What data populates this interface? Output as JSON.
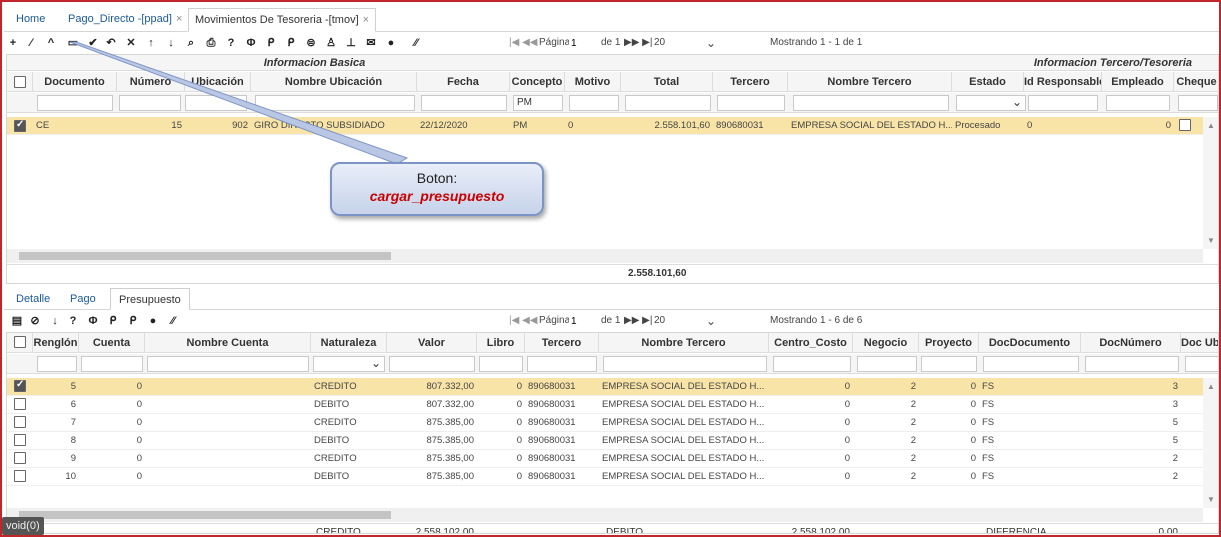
{
  "tabs": [
    {
      "label": "Home"
    },
    {
      "label": "Pago_Directo -[ppad]",
      "close": "×"
    },
    {
      "label": "Movimientos De Tesoreria -[tmov]",
      "close": "×"
    }
  ],
  "toolbar": {
    "icons": [
      {
        "name": "add-icon",
        "glyph": "+"
      },
      {
        "name": "edit-icon",
        "glyph": "⁄"
      },
      {
        "name": "up-icon",
        "glyph": "^"
      },
      {
        "name": "rectangle-icon",
        "glyph": "▭"
      },
      {
        "name": "check-icon",
        "glyph": "✔"
      },
      {
        "name": "undo-icon",
        "glyph": "↶"
      },
      {
        "name": "cancel-icon",
        "glyph": "✕"
      },
      {
        "name": "arrow-up-icon",
        "glyph": "↑"
      },
      {
        "name": "arrow-down-icon",
        "glyph": "↓"
      },
      {
        "name": "search-icon",
        "glyph": "⌕"
      },
      {
        "name": "print-icon",
        "glyph": "⎙"
      },
      {
        "name": "help-icon",
        "glyph": "?"
      },
      {
        "name": "filter-icon",
        "glyph": "Φ"
      },
      {
        "name": "zoom-in-icon",
        "glyph": "ᑭ"
      },
      {
        "name": "zoom-out-icon",
        "glyph": "ᑭ"
      },
      {
        "name": "comment-icon",
        "glyph": "⊜"
      },
      {
        "name": "user-icon",
        "glyph": "♙"
      },
      {
        "name": "pin-icon",
        "glyph": "⊥"
      },
      {
        "name": "mail-icon",
        "glyph": "✉"
      },
      {
        "name": "add-circle-icon",
        "glyph": "●"
      },
      {
        "name": "resize-icon",
        "glyph": "⁄⁄"
      }
    ],
    "pager": {
      "nav_left": "|◀ ◀◀",
      "page_label": "Página",
      "page": "1",
      "of": "de 1",
      "nav_right": "▶▶ ▶|",
      "per_page": "20",
      "caret": "⌄",
      "showing": "Mostrando 1 - 1 de 1"
    }
  },
  "master": {
    "group_basic": "Informacion Basica",
    "group_third": "Informacion Tercero/Tesoreria",
    "columns": [
      "Documento",
      "Número",
      "Ubicación",
      "Nombre Ubicación",
      "Fecha",
      "Concepto",
      "Motivo",
      "Total",
      "Tercero",
      "Nombre Tercero",
      "Estado",
      "Id Responsable",
      "Empleado",
      "Cheque"
    ],
    "filter_concepto": "PM",
    "filter_estado_caret": "⌄",
    "row": {
      "documento": "CE",
      "numero": "15",
      "ubicacion": "902",
      "nombre_ubicacion": "GIRO DIRECTO SUBSIDIADO",
      "fecha": "22/12/2020",
      "concepto": "PM",
      "motivo": "0",
      "total": "2.558.101,60",
      "tercero": "890680031",
      "nombre_tercero": "EMPRESA SOCIAL DEL ESTADO H...",
      "estado": "Procesado",
      "id_responsable": "0",
      "empleado": "0"
    },
    "footer_total": "2.558.101,60"
  },
  "tooltip": {
    "line1": "Boton:",
    "line2": "cargar_presupuesto"
  },
  "subtabs": [
    {
      "label": "Detalle"
    },
    {
      "label": "Pago"
    },
    {
      "label": "Presupuesto"
    }
  ],
  "detail_toolbar": {
    "icons": [
      {
        "name": "save-icon",
        "glyph": "▤"
      },
      {
        "name": "block-icon",
        "glyph": "⊘"
      },
      {
        "name": "arrow-down-icon",
        "glyph": "↓"
      },
      {
        "name": "help-icon",
        "glyph": "?"
      },
      {
        "name": "filter-icon",
        "glyph": "Φ"
      },
      {
        "name": "zoom-in-icon",
        "glyph": "ᑭ"
      },
      {
        "name": "zoom-out-icon",
        "glyph": "ᑭ"
      },
      {
        "name": "add-circle-icon",
        "glyph": "●"
      },
      {
        "name": "resize-icon",
        "glyph": "⁄⁄"
      }
    ],
    "pager": {
      "nav_left": "|◀ ◀◀",
      "page_label": "Página",
      "page": "1",
      "of": "de 1",
      "nav_right": "▶▶ ▶|",
      "per_page": "20",
      "caret": "⌄",
      "showing": "Mostrando 1 - 6 de 6"
    }
  },
  "detail": {
    "columns": [
      "Renglón",
      "Cuenta",
      "Nombre Cuenta",
      "Naturaleza",
      "Valor",
      "Libro",
      "Tercero",
      "Nombre Tercero",
      "Centro_Costo",
      "Negocio",
      "Proyecto",
      "DocDocumento",
      "DocNúmero",
      "Doc Ub"
    ],
    "naturaleza_caret": "⌄",
    "rows": [
      {
        "renglon": "5",
        "cuenta": "0",
        "naturaleza": "CREDITO",
        "valor": "807.332,00",
        "libro": "0",
        "tercero": "890680031",
        "nombre_tercero": "EMPRESA SOCIAL DEL ESTADO H...",
        "centro": "0",
        "negocio": "2",
        "proyecto": "0",
        "docdoc": "FS",
        "docnum": "3",
        "selected": true
      },
      {
        "renglon": "6",
        "cuenta": "0",
        "naturaleza": "DEBITO",
        "valor": "807.332,00",
        "libro": "0",
        "tercero": "890680031",
        "nombre_tercero": "EMPRESA SOCIAL DEL ESTADO H...",
        "centro": "0",
        "negocio": "2",
        "proyecto": "0",
        "docdoc": "FS",
        "docnum": "3",
        "selected": false
      },
      {
        "renglon": "7",
        "cuenta": "0",
        "naturaleza": "CREDITO",
        "valor": "875.385,00",
        "libro": "0",
        "tercero": "890680031",
        "nombre_tercero": "EMPRESA SOCIAL DEL ESTADO H...",
        "centro": "0",
        "negocio": "2",
        "proyecto": "0",
        "docdoc": "FS",
        "docnum": "5",
        "selected": false
      },
      {
        "renglon": "8",
        "cuenta": "0",
        "naturaleza": "DEBITO",
        "valor": "875.385,00",
        "libro": "0",
        "tercero": "890680031",
        "nombre_tercero": "EMPRESA SOCIAL DEL ESTADO H...",
        "centro": "0",
        "negocio": "2",
        "proyecto": "0",
        "docdoc": "FS",
        "docnum": "5",
        "selected": false
      },
      {
        "renglon": "9",
        "cuenta": "0",
        "naturaleza": "CREDITO",
        "valor": "875.385,00",
        "libro": "0",
        "tercero": "890680031",
        "nombre_tercero": "EMPRESA SOCIAL DEL ESTADO H...",
        "centro": "0",
        "negocio": "2",
        "proyecto": "0",
        "docdoc": "FS",
        "docnum": "2",
        "selected": false
      },
      {
        "renglon": "10",
        "cuenta": "0",
        "naturaleza": "DEBITO",
        "valor": "875.385,00",
        "libro": "0",
        "tercero": "890680031",
        "nombre_tercero": "EMPRESA SOCIAL DEL ESTADO H...",
        "centro": "0",
        "negocio": "2",
        "proyecto": "0",
        "docdoc": "FS",
        "docnum": "2",
        "selected": false
      }
    ],
    "footer": {
      "credito_label": "CREDITO",
      "credito_total": "2.558.102,00",
      "debito_label": "DEBITO",
      "debito_total": "2.558.102,00",
      "diferencia_label": "DIFERENCIA",
      "diferencia_value": "0,00"
    }
  },
  "status_text": "void(0)"
}
